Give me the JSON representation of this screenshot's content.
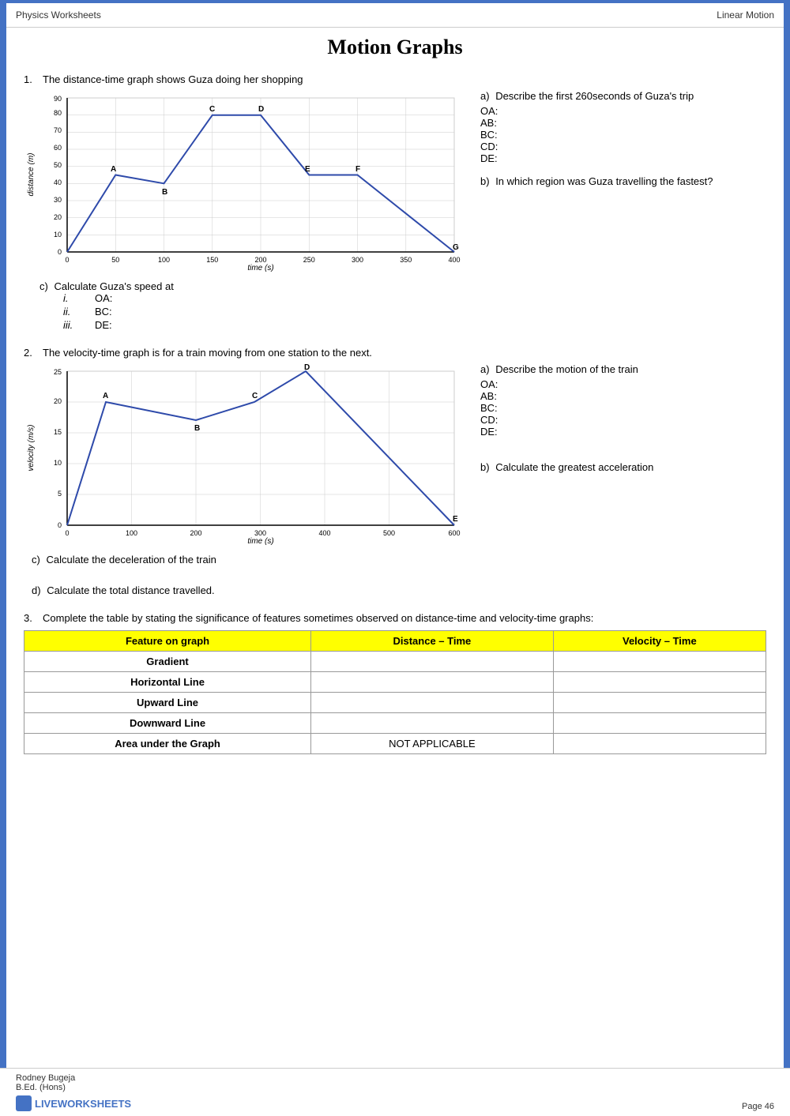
{
  "header": {
    "left": "Physics Worksheets",
    "right": "Linear Motion"
  },
  "title": "Motion Graphs",
  "question1": {
    "number": "1.",
    "text": "The distance-time graph shows Guza doing her shopping",
    "graph": {
      "xLabel": "time (s)",
      "yLabel": "distance (m)",
      "xMax": 400,
      "yMax": 90
    },
    "partA": {
      "label": "a)",
      "text": "Describe the first 260seconds of Guza's trip",
      "lines": [
        "OA:",
        "AB:",
        "BC:",
        "CD:",
        "DE:"
      ]
    },
    "partB": {
      "label": "b)",
      "text": "In  which  region  was  Guza travelling the fastest?"
    },
    "partC": {
      "label": "c)",
      "text": "Calculate Guza's speed at",
      "items": [
        {
          "num": "i.",
          "text": "OA:"
        },
        {
          "num": "ii.",
          "text": "BC:"
        },
        {
          "num": "iii.",
          "text": "DE:"
        }
      ]
    }
  },
  "question2": {
    "number": "2.",
    "text": "The velocity-time graph is for a train moving from one station to the next.",
    "graph": {
      "xLabel": "time (s)",
      "yLabel": "velocity (m/s)",
      "xMax": 600,
      "yMax": 25
    },
    "partA": {
      "label": "a)",
      "text": "Describe the motion of the train",
      "lines": [
        "OA:",
        "AB:",
        "BC:",
        "CD:",
        "DE:"
      ]
    },
    "partB": {
      "label": "b)",
      "text": "Calculate     the     greatest acceleration"
    },
    "partC": {
      "label": "c)",
      "text": "Calculate the deceleration of the train"
    },
    "partD": {
      "label": "d)",
      "text": "Calculate the total distance travelled."
    }
  },
  "question3": {
    "number": "3.",
    "text": "Complete the table by stating the significance of features sometimes observed on distance-time and velocity-time graphs:",
    "table": {
      "headers": [
        "Feature on graph",
        "Distance – Time",
        "Velocity – Time"
      ],
      "rows": [
        [
          "Gradient",
          "",
          ""
        ],
        [
          "Horizontal Line",
          "",
          ""
        ],
        [
          "Upward Line",
          "",
          ""
        ],
        [
          "Downward Line",
          "",
          ""
        ],
        [
          "Area under the Graph",
          "NOT APPLICABLE",
          ""
        ]
      ]
    }
  },
  "footer": {
    "author": "Rodney Bugeja",
    "qualification": "B.Ed. (Hons)",
    "page": "Page 46",
    "brand": "LIVEWORKSHEETS"
  }
}
